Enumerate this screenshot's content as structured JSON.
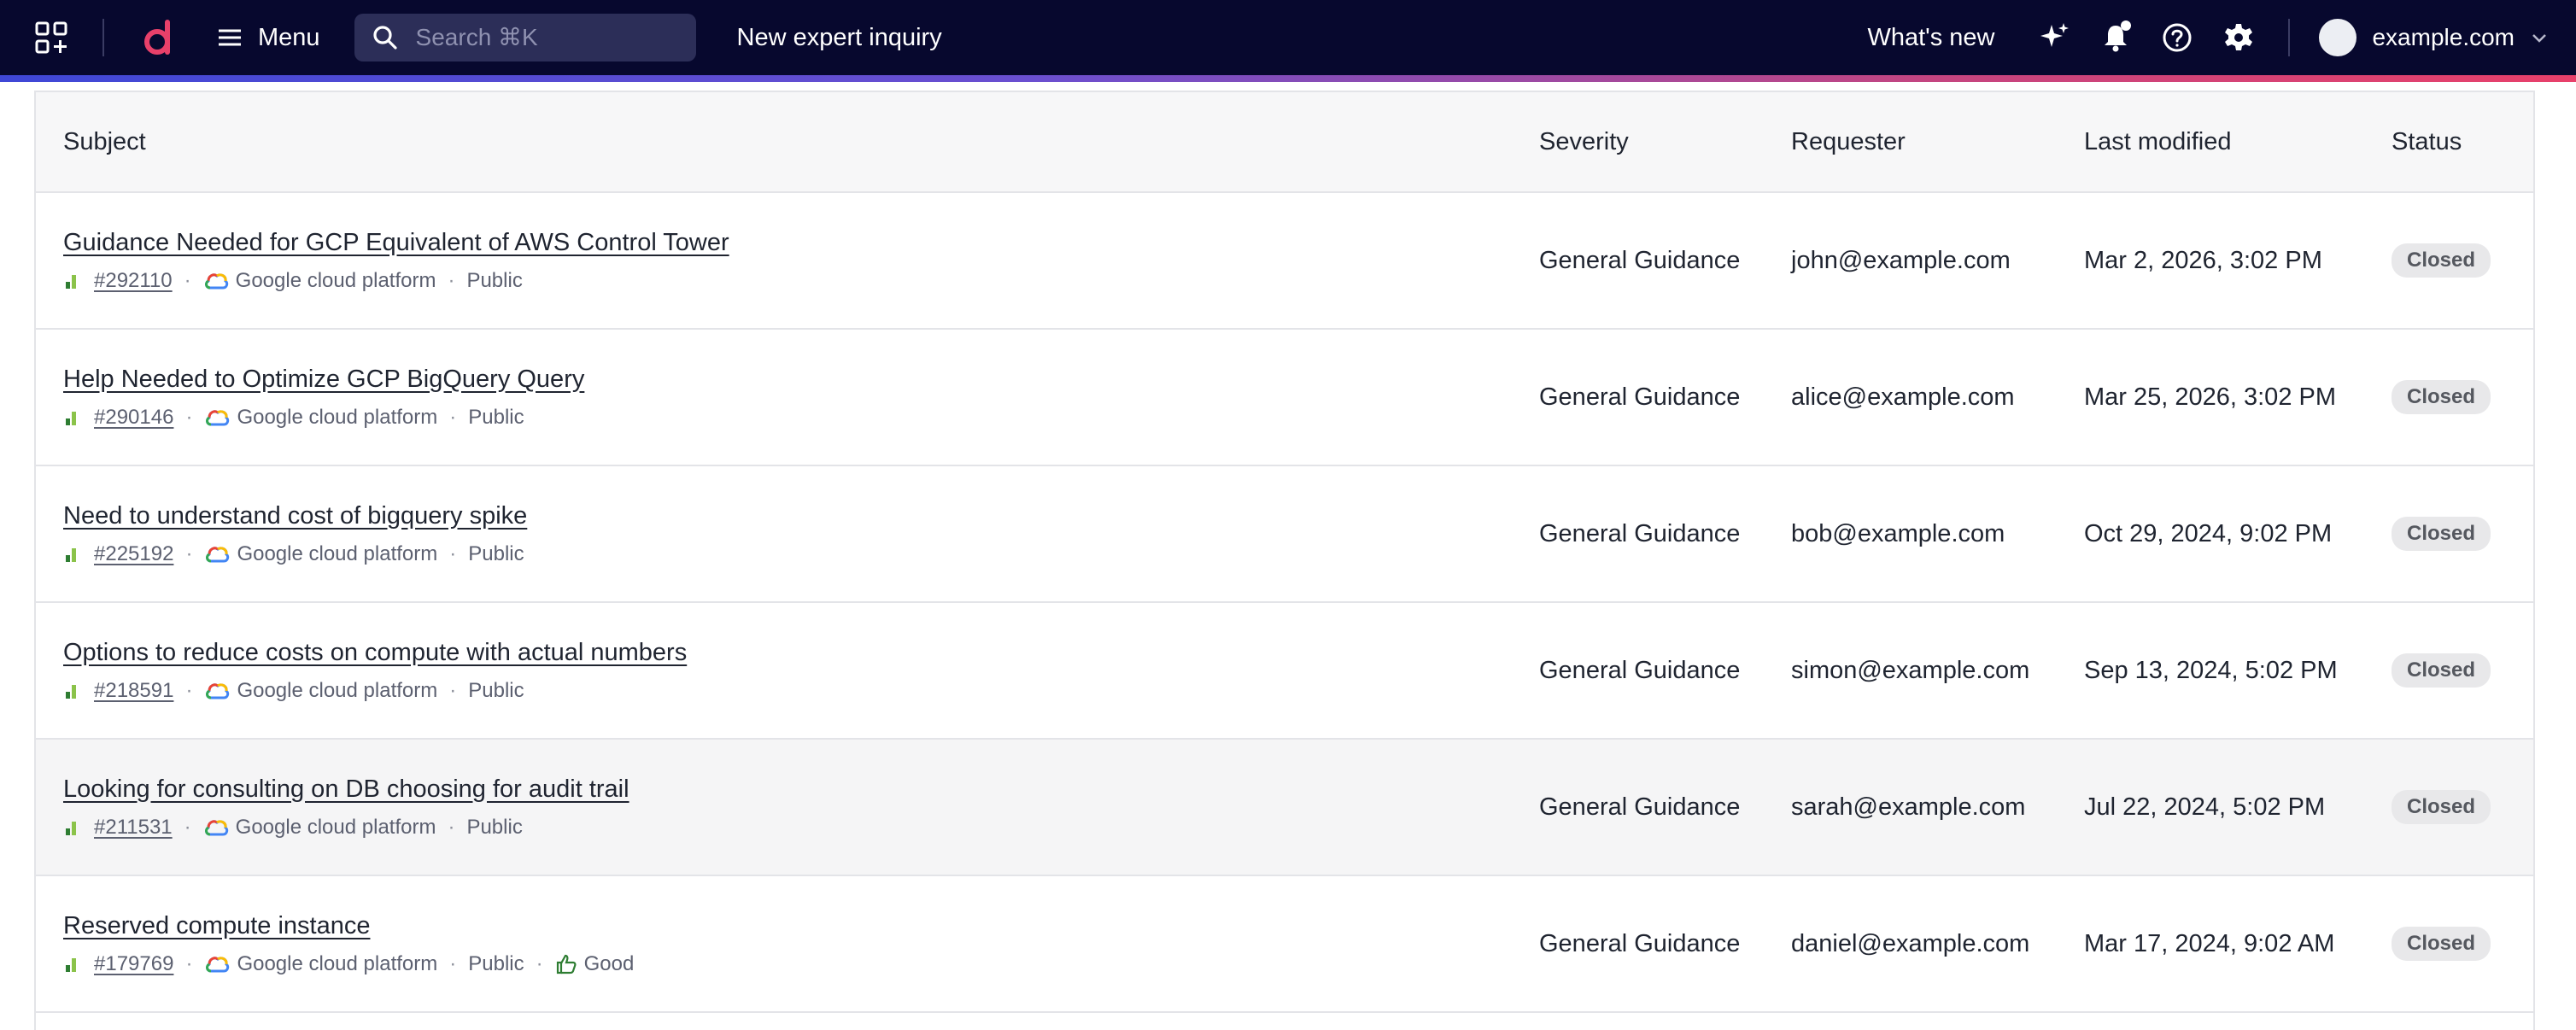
{
  "nav": {
    "menu_label": "Menu",
    "search_placeholder": "Search ⌘K",
    "new_inquiry": "New expert inquiry",
    "whats_new": "What's new",
    "account": "example.com"
  },
  "table": {
    "headers": {
      "subject": "Subject",
      "severity": "Severity",
      "requester": "Requester",
      "last_modified": "Last modified",
      "status": "Status"
    },
    "rows": [
      {
        "title": "Guidance Needed for GCP Equivalent of AWS Control Tower",
        "ticket": "#292110",
        "platform": "Google cloud platform",
        "visibility": "Public",
        "severity": "General Guidance",
        "requester": "john@example.com",
        "modified": "Mar 2, 2026, 3:02 PM",
        "status": "Closed"
      },
      {
        "title": "Help Needed to Optimize GCP BigQuery Query",
        "ticket": "#290146",
        "platform": "Google cloud platform",
        "visibility": "Public",
        "severity": "General Guidance",
        "requester": "alice@example.com",
        "modified": "Mar 25, 2026, 3:02 PM",
        "status": "Closed"
      },
      {
        "title": "Need to understand cost of bigquery spike",
        "ticket": "#225192",
        "platform": "Google cloud platform",
        "visibility": "Public",
        "severity": "General Guidance",
        "requester": "bob@example.com",
        "modified": "Oct 29, 2024, 9:02 PM",
        "status": "Closed"
      },
      {
        "title": "Options to reduce costs on compute with actual numbers",
        "ticket": "#218591",
        "platform": "Google cloud platform",
        "visibility": "Public",
        "severity": "General Guidance",
        "requester": "simon@example.com",
        "modified": "Sep 13, 2024, 5:02 PM",
        "status": "Closed"
      },
      {
        "title": "Looking for consulting on DB choosing for audit trail",
        "ticket": "#211531",
        "platform": "Google cloud platform",
        "visibility": "Public",
        "severity": "General Guidance",
        "requester": "sarah@example.com",
        "modified": "Jul 22, 2024, 5:02 PM",
        "status": "Closed"
      },
      {
        "title": "Reserved compute instance",
        "ticket": "#179769",
        "platform": "Google cloud platform",
        "visibility": "Public",
        "rating": "Good",
        "severity": "General Guidance",
        "requester": "daniel@example.com",
        "modified": "Mar 17, 2024, 9:02 AM",
        "status": "Closed"
      }
    ]
  },
  "colors": {
    "nav_bg": "#07082e",
    "logo_pink": "#e8406a",
    "status_bg": "#e8e8ea"
  }
}
